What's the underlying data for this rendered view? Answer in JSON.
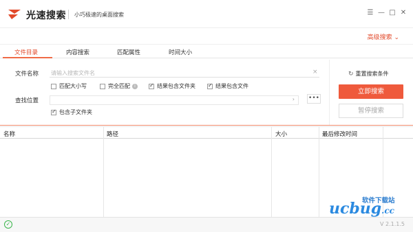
{
  "window": {
    "app_title": "光速搜索",
    "app_subtitle": "小巧极速的桌面搜索",
    "controls": {
      "menu": "☰",
      "minimize": "—",
      "maximize": "□",
      "close": "✕"
    },
    "brand_color": "#ef5a3c"
  },
  "toolbar": {
    "advanced_search": "高级搜索 ⌄"
  },
  "tabs": [
    {
      "label": "文件目录",
      "active": true
    },
    {
      "label": "内容搜索",
      "active": false
    },
    {
      "label": "匹配属性",
      "active": false
    },
    {
      "label": "时间大小",
      "active": false
    }
  ],
  "search": {
    "filename_label": "文件名称",
    "filename_placeholder": "请输入搜索文件名",
    "clear_icon": "×",
    "options": [
      {
        "label": "匹配大小写",
        "checked": false
      },
      {
        "label": "完全匹配",
        "checked": false,
        "info": "i"
      },
      {
        "label": "结果包含文件夹",
        "checked": true
      },
      {
        "label": "结果包含文件",
        "checked": true
      }
    ],
    "location_label": "查找位置",
    "location_value": "",
    "location_arrow": "›",
    "more_label": "•••",
    "include_subfolders": {
      "label": "包含子文件夹",
      "checked": true
    }
  },
  "actions": {
    "reset_icon": "↻",
    "reset_label": "重置搜索条件",
    "start_label": "立即搜索",
    "pause_label": "暂停搜索"
  },
  "results": {
    "columns": [
      "名称",
      "路径",
      "大小",
      "最后修改时间"
    ],
    "rows": []
  },
  "status": {
    "ok_icon": "✓",
    "version": "V 2.1.1.5"
  },
  "watermark": {
    "text": "软件下载站",
    "logo": "ucbug",
    "suffix": ".cc"
  }
}
